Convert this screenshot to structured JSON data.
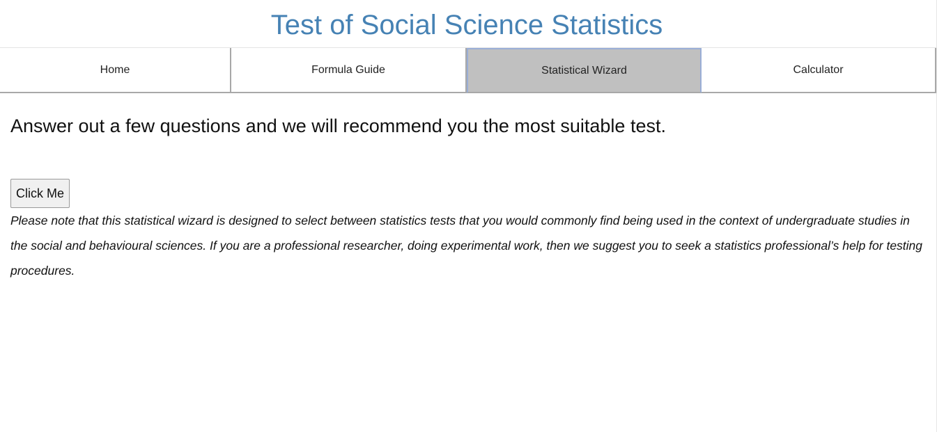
{
  "header": {
    "title": "Test of Social Science Statistics"
  },
  "nav": {
    "items": [
      {
        "label": "Home",
        "active": false
      },
      {
        "label": "Formula Guide",
        "active": false
      },
      {
        "label": "Statistical Wizard",
        "active": true
      },
      {
        "label": "Calculator",
        "active": false
      }
    ]
  },
  "main": {
    "lead": "Answer out a few questions and we will recommend you the most suitable test.",
    "button_label": "Click Me",
    "note": "Please note that this statistical wizard is designed to select between statistics tests that you would commonly find being used in the context of undergraduate studies in the social and behavioural sciences. If you are a professional researcher, doing experimental work, then we suggest you to seek a statistics professional’s help for testing procedures."
  },
  "colors": {
    "title": "#4682b4",
    "active_tab_bg": "#c0c0c0"
  }
}
